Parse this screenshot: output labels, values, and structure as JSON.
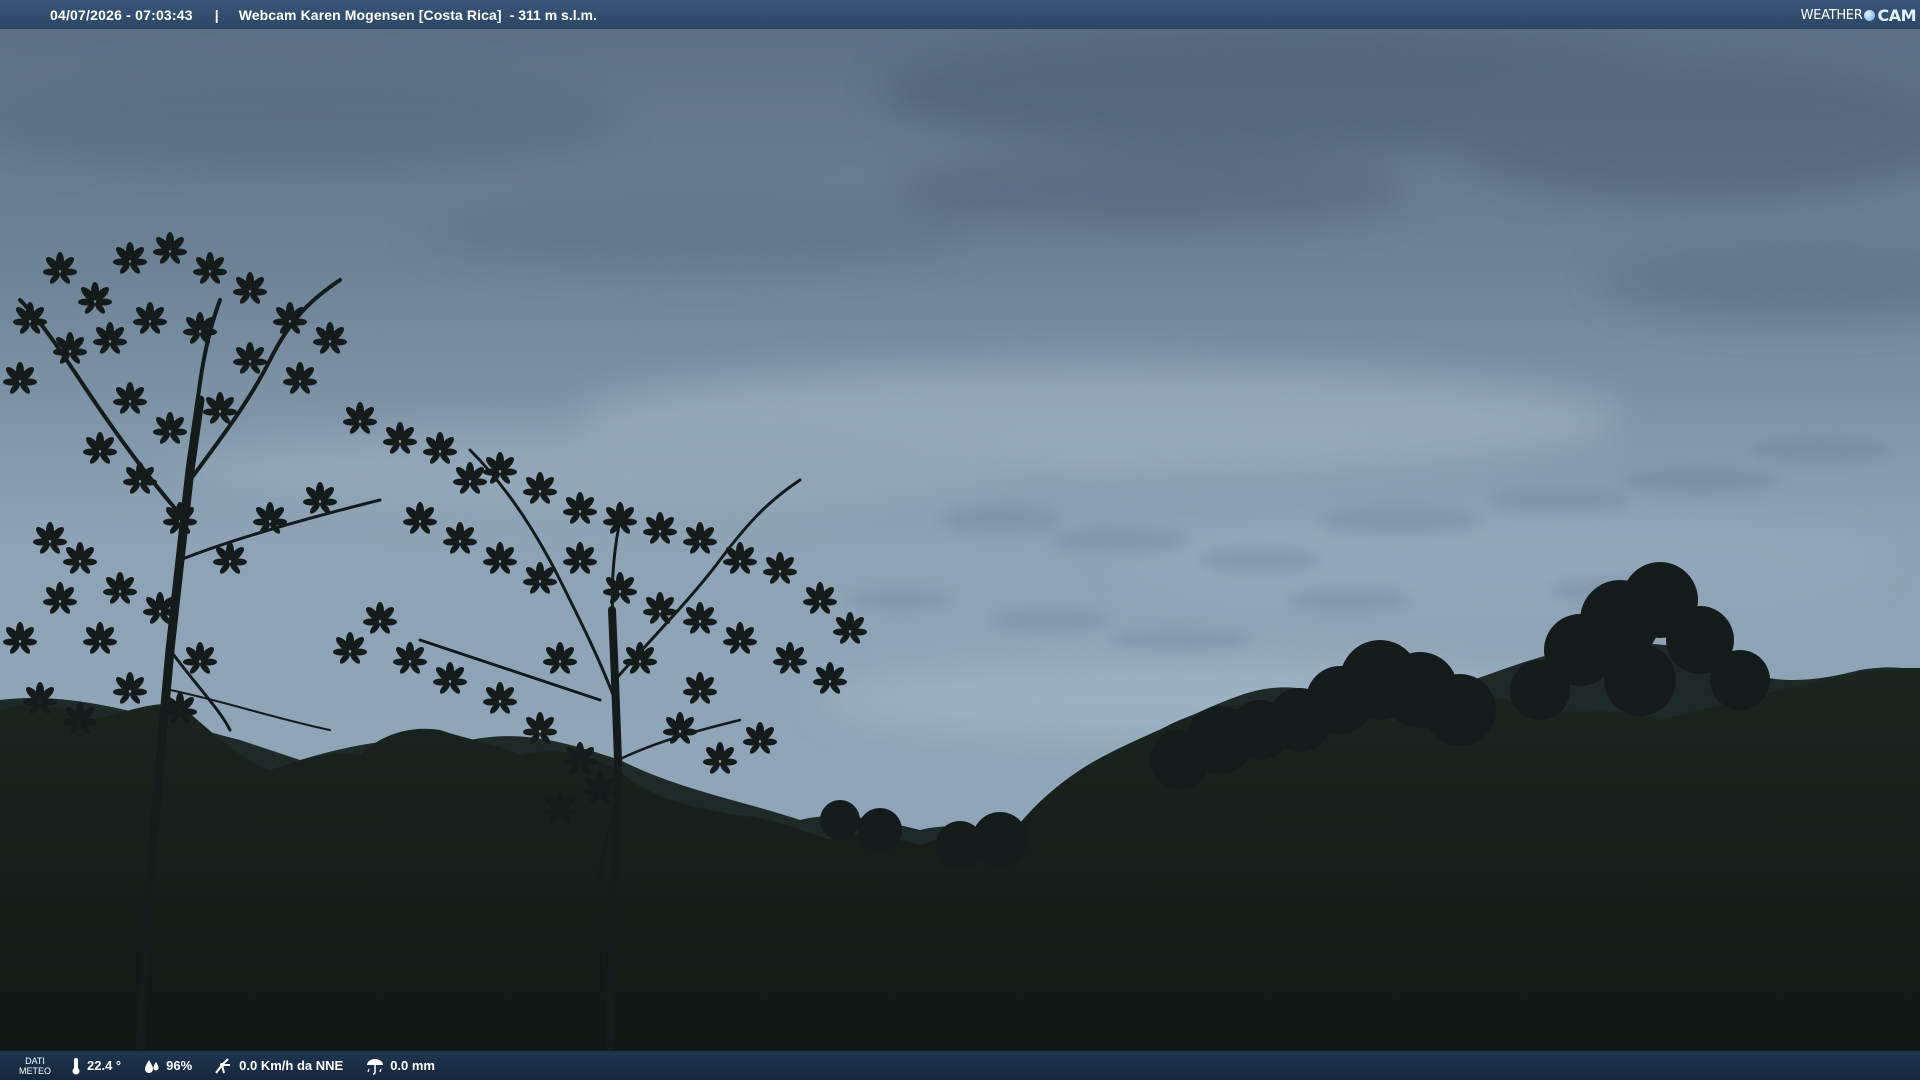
{
  "header": {
    "timestamp": "04/07/2026 - 07:03:43",
    "separator": "|",
    "title": "Webcam Karen Mogensen [Costa Rica]",
    "elevation": "- 311 m s.l.m."
  },
  "logo": {
    "weather": "WEATHER",
    "cam": "CAM"
  },
  "footer": {
    "label_line1": "DATI",
    "label_line2": "METEO",
    "temperature": "22.4 °",
    "humidity": "96%",
    "wind": "0.0 Km/h da NNE",
    "rain": "0.0 mm"
  },
  "colors": {
    "sky_top": "#5f7288",
    "sky_mid": "#8ea2b4",
    "forest": "#141d19",
    "bar": "#2f4a6b"
  },
  "icons": {
    "temperature": "thermometer-icon",
    "humidity": "drops-icon",
    "wind": "wind-icon",
    "rain": "rain-icon"
  }
}
